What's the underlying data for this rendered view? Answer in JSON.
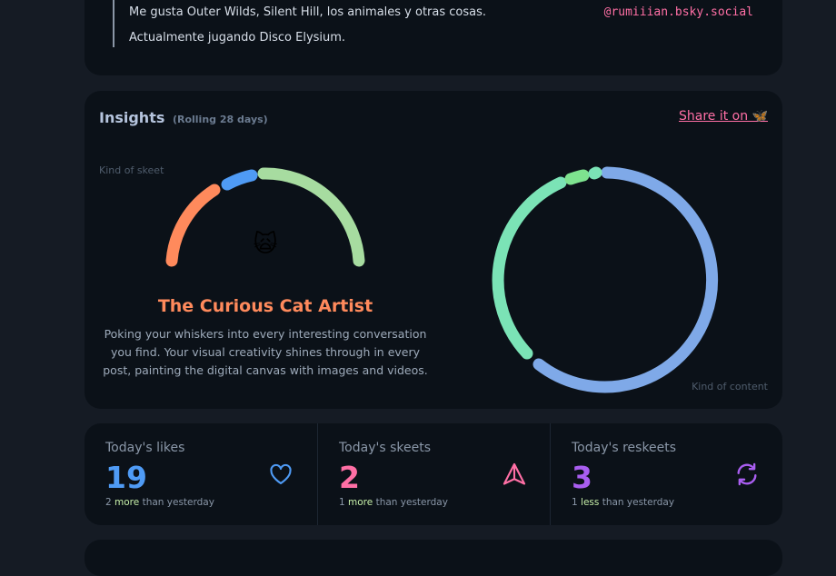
{
  "profile": {
    "bio_line_1": "Me gusta Outer Wilds, Silent Hill, los animales y otras cosas.",
    "bio_line_2": "Actualmente jugando Disco Elysium.",
    "handle": "@rumiiian.bsky.social"
  },
  "insights": {
    "title": "Insights",
    "subtitle": "(Rolling 28 days)",
    "share_label": "Share it on 🦋",
    "kind_of_skeet_label": "Kind of skeet",
    "kind_of_content_label": "Kind of content",
    "mascot_emoji": "🙀",
    "archetype_title": "The Curious Cat Artist",
    "archetype_description": "Poking your whiskers into every interesting conversation you find. Your visual creativity shines through in every post, painting the digital canvas with images and videos.",
    "skeet_gauge_colors": [
      "#ff8a5c",
      "#4f9bf5",
      "#a7dca0"
    ],
    "content_ring_colors": [
      "#7fa9e8",
      "#7be3b6",
      "#7ee38f",
      "#7be3b6"
    ]
  },
  "stats": [
    {
      "label": "Today's likes",
      "value": "19",
      "diff": "2",
      "word": "more",
      "suffix": "than yesterday",
      "color": "#4f9bf5",
      "icon": "heart-icon"
    },
    {
      "label": "Today's skeets",
      "value": "2",
      "diff": "1",
      "word": "more",
      "suffix": "than yesterday",
      "color": "#ff6fa5",
      "icon": "send-icon"
    },
    {
      "label": "Today's reskeets",
      "value": "3",
      "diff": "1",
      "word": "less",
      "suffix": "than yesterday",
      "color": "#a95ef0",
      "icon": "repost-icon"
    }
  ]
}
